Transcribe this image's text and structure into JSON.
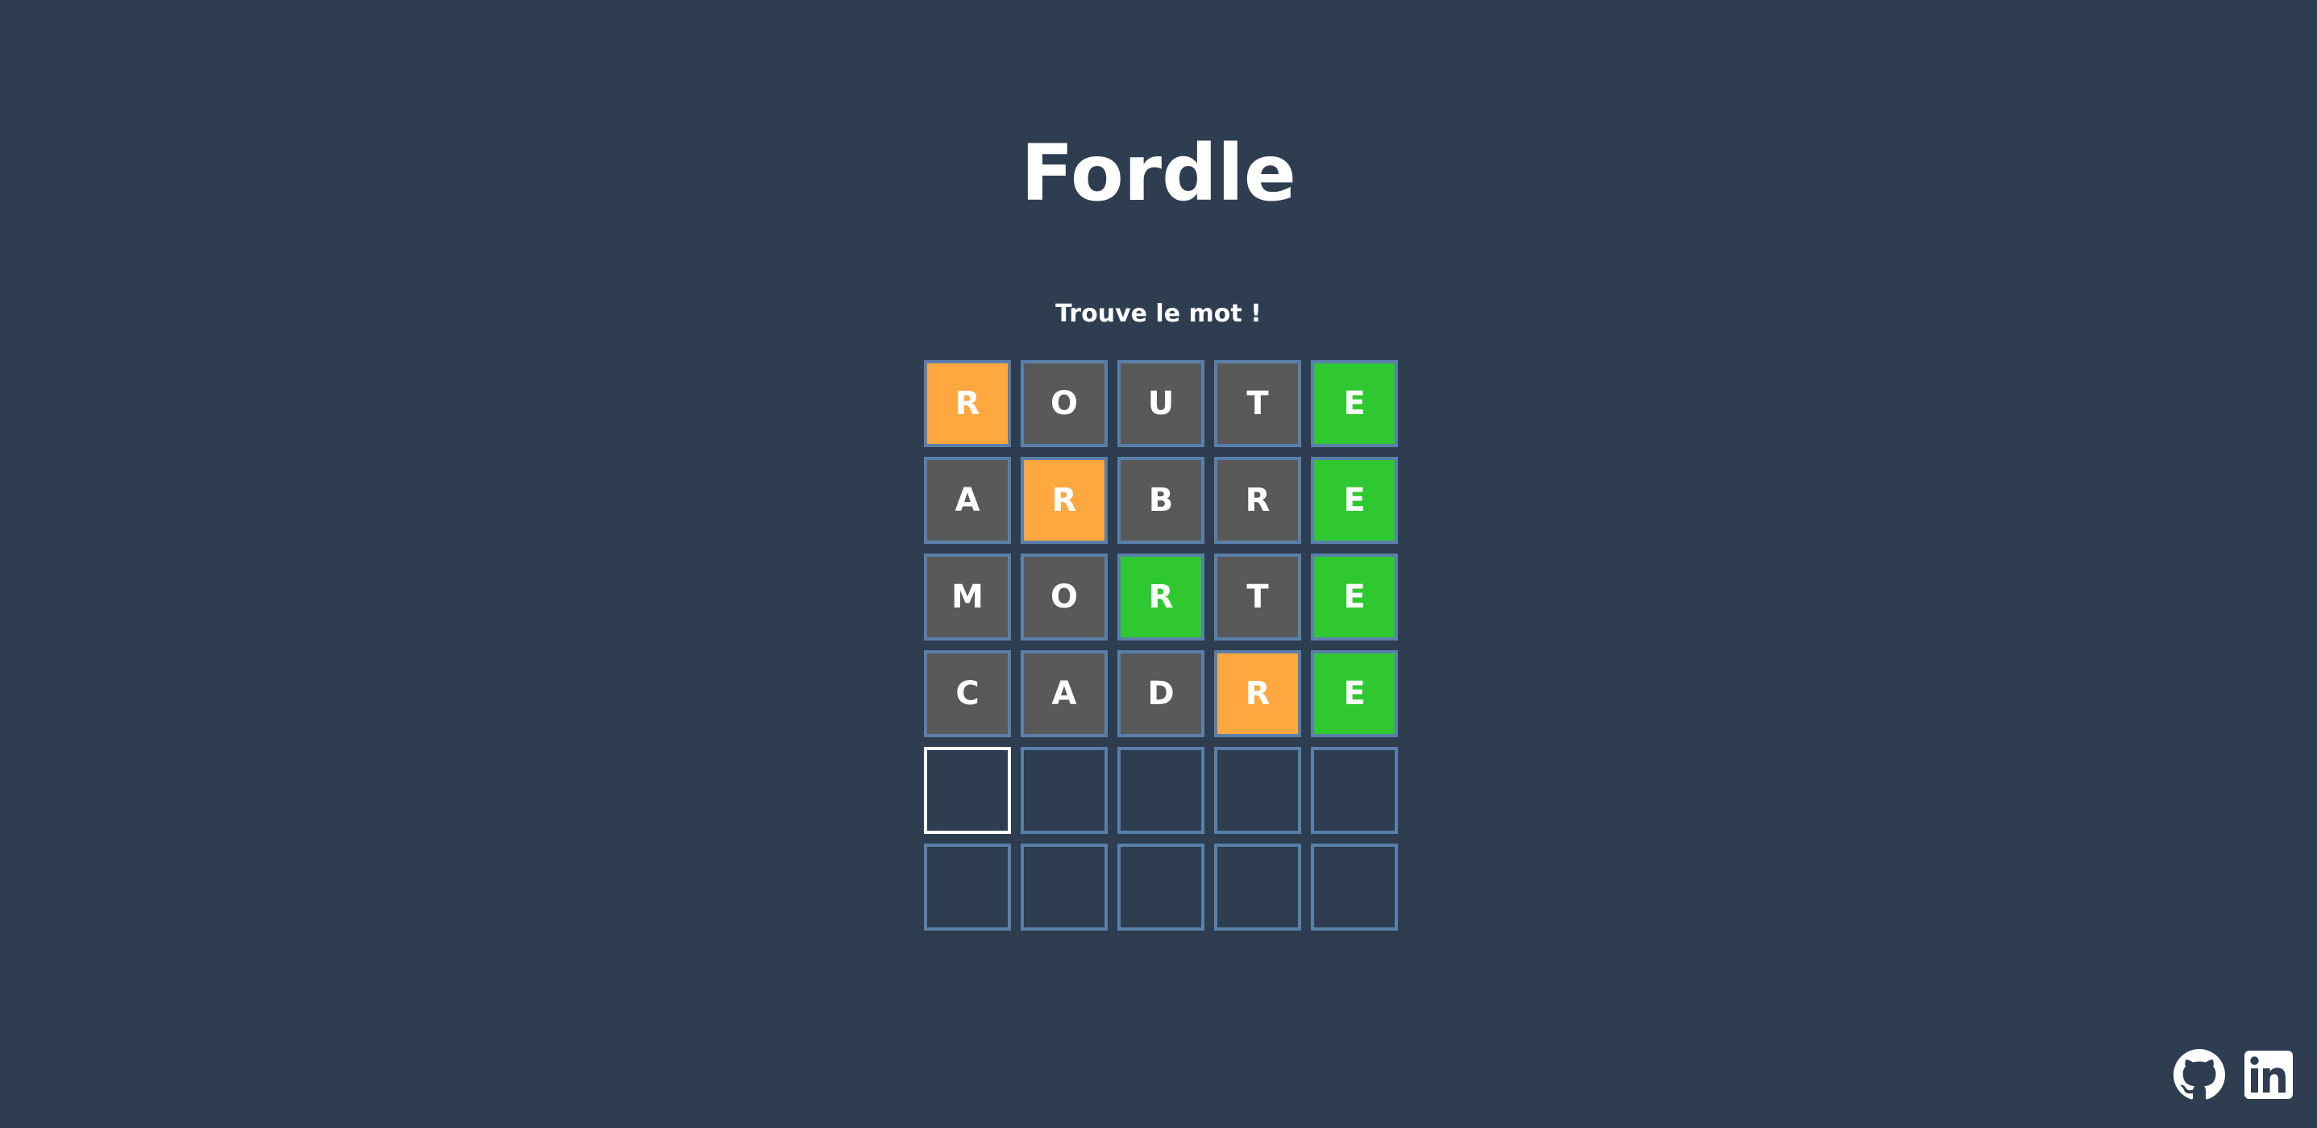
{
  "title": "Fordle",
  "subtitle": "Trouve le mot !",
  "colors": {
    "background": "#2e3d50",
    "absent": "#595959",
    "present": "#ffa840",
    "correct": "#30c830",
    "tile_border": "#5a80aa",
    "active_border": "#ffffff"
  },
  "board": {
    "rows": [
      [
        {
          "letter": "R",
          "state": "present"
        },
        {
          "letter": "O",
          "state": "absent"
        },
        {
          "letter": "U",
          "state": "absent"
        },
        {
          "letter": "T",
          "state": "absent"
        },
        {
          "letter": "E",
          "state": "correct"
        }
      ],
      [
        {
          "letter": "A",
          "state": "absent"
        },
        {
          "letter": "R",
          "state": "present"
        },
        {
          "letter": "B",
          "state": "absent"
        },
        {
          "letter": "R",
          "state": "absent"
        },
        {
          "letter": "E",
          "state": "correct"
        }
      ],
      [
        {
          "letter": "M",
          "state": "absent"
        },
        {
          "letter": "O",
          "state": "absent"
        },
        {
          "letter": "R",
          "state": "correct"
        },
        {
          "letter": "T",
          "state": "absent"
        },
        {
          "letter": "E",
          "state": "correct"
        }
      ],
      [
        {
          "letter": "C",
          "state": "absent"
        },
        {
          "letter": "A",
          "state": "absent"
        },
        {
          "letter": "D",
          "state": "absent"
        },
        {
          "letter": "R",
          "state": "present"
        },
        {
          "letter": "E",
          "state": "correct"
        }
      ],
      [
        {
          "letter": "",
          "state": "active"
        },
        {
          "letter": "",
          "state": "empty"
        },
        {
          "letter": "",
          "state": "empty"
        },
        {
          "letter": "",
          "state": "empty"
        },
        {
          "letter": "",
          "state": "empty"
        }
      ],
      [
        {
          "letter": "",
          "state": "empty"
        },
        {
          "letter": "",
          "state": "empty"
        },
        {
          "letter": "",
          "state": "empty"
        },
        {
          "letter": "",
          "state": "empty"
        },
        {
          "letter": "",
          "state": "empty"
        }
      ]
    ]
  },
  "footer": {
    "icons": [
      "github-icon",
      "linkedin-icon"
    ]
  }
}
